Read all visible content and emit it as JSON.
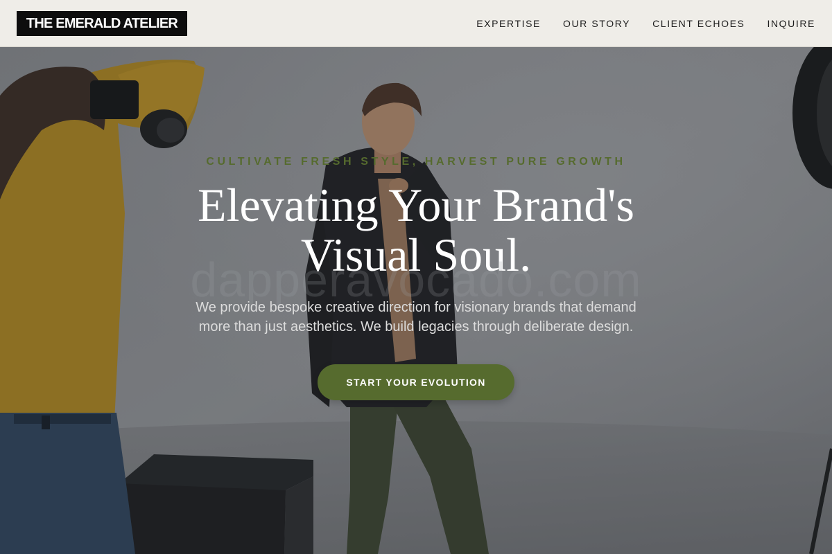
{
  "header": {
    "logo": "THE EMERALD ATELIER",
    "nav": [
      {
        "label": "EXPERTISE"
      },
      {
        "label": "OUR STORY"
      },
      {
        "label": "CLIENT ECHOES"
      },
      {
        "label": "INQUIRE"
      }
    ]
  },
  "hero": {
    "eyebrow": "CULTIVATE FRESH STYLE, HARVEST PURE GROWTH",
    "headline_line1": "Elevating Your Brand's",
    "headline_line2": "Visual Soul.",
    "watermark": "dapperavocado.com",
    "subtext_line1": "We provide bespoke creative direction for visionary brands that demand",
    "subtext_line2": "more than just aesthetics. We build legacies through deliberate design.",
    "cta_label": "START YOUR EVOLUTION"
  },
  "colors": {
    "header_bg": "#efede8",
    "logo_bg": "#0d0d0d",
    "accent_green": "#566b2e",
    "headline": "#ffffff"
  }
}
